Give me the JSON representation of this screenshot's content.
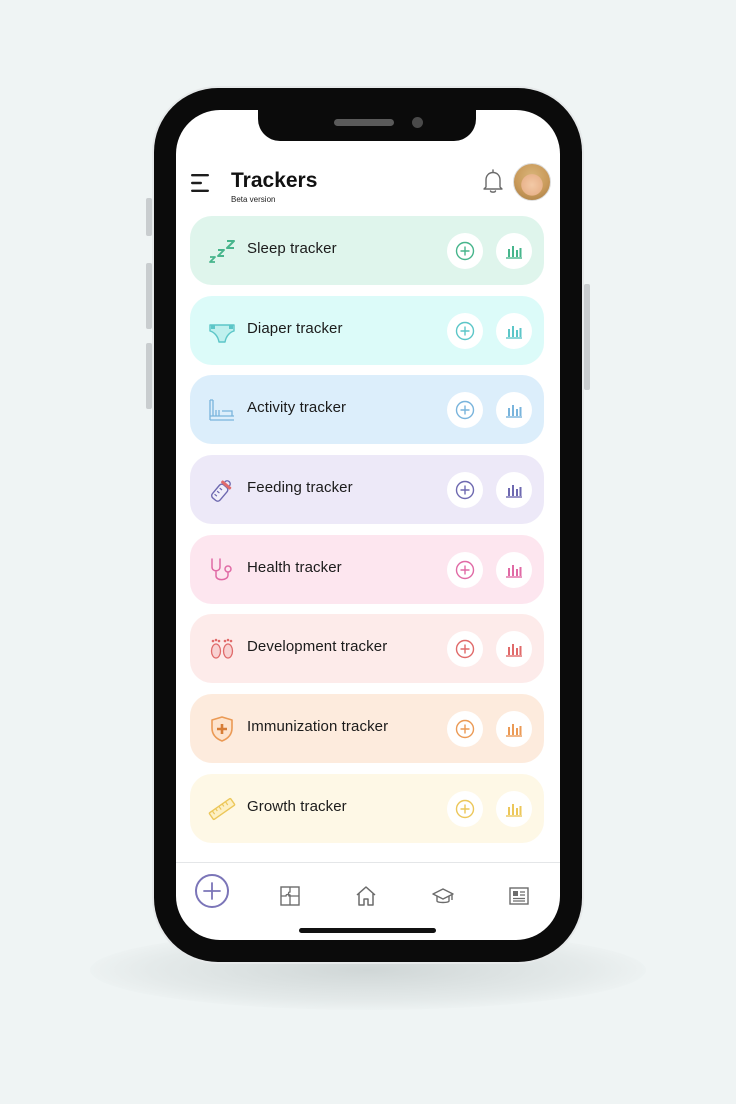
{
  "header": {
    "title": "Trackers",
    "subtitle": "Beta version"
  },
  "trackers": [
    {
      "label": "Sleep tracker",
      "icon": "sleep-zzz-icon",
      "bg": "#dff5ec",
      "accent": "#47b58c"
    },
    {
      "label": "Diaper tracker",
      "icon": "diaper-icon",
      "bg": "#dcfbf9",
      "accent": "#5cc6c8"
    },
    {
      "label": "Activity tracker",
      "icon": "activity-crib-icon",
      "bg": "#dceefb",
      "accent": "#79b4dc"
    },
    {
      "label": "Feeding tracker",
      "icon": "baby-bottle-icon",
      "bg": "#ede9f8",
      "accent": "#6e69b0"
    },
    {
      "label": "Health tracker",
      "icon": "stethoscope-icon",
      "bg": "#fde6ef",
      "accent": "#e06aa5"
    },
    {
      "label": "Development tracker",
      "icon": "baby-feet-icon",
      "bg": "#fdebea",
      "accent": "#e06a6a"
    },
    {
      "label": "Immunization tracker",
      "icon": "shield-cross-icon",
      "bg": "#fdebdd",
      "accent": "#eb9a55"
    },
    {
      "label": "Growth tracker",
      "icon": "ruler-icon",
      "bg": "#fef8e6",
      "accent": "#ecc75a"
    }
  ],
  "nav": [
    "add-icon",
    "puzzle-icon",
    "home-icon",
    "graduation-cap-icon",
    "newspaper-icon"
  ],
  "colors": {
    "nav_accent": "#7b75b8",
    "nav_icon": "#6b6b6b"
  }
}
